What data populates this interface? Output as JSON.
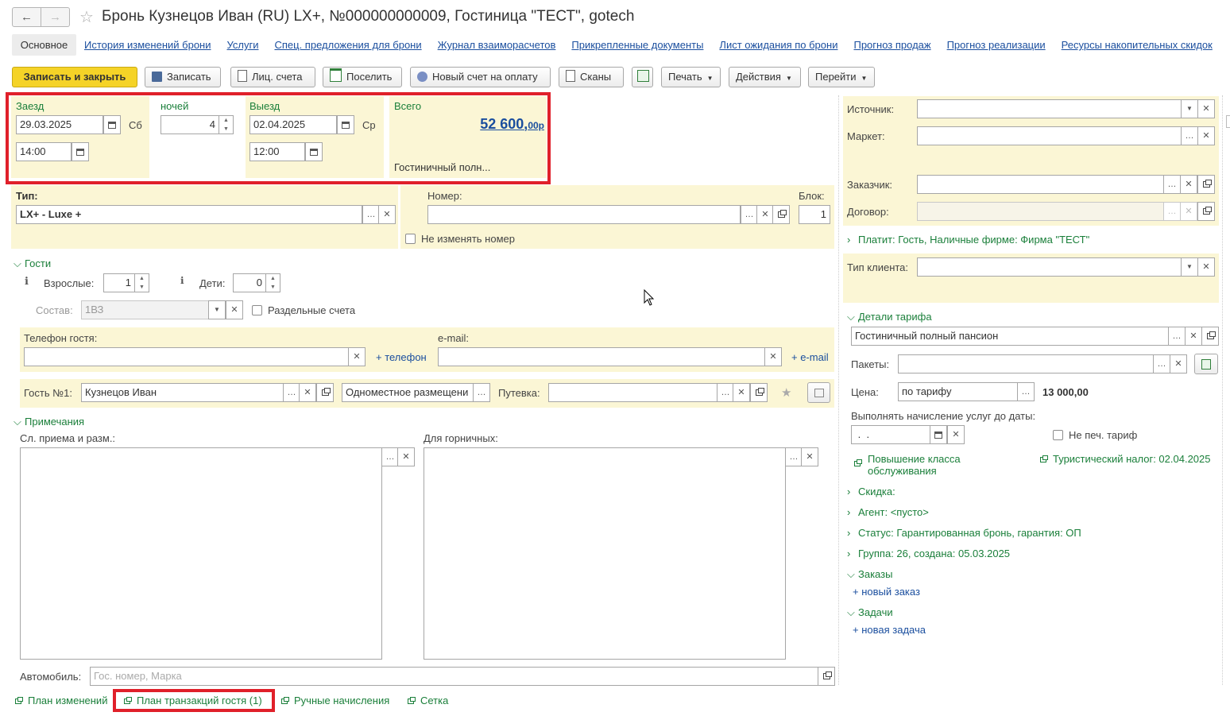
{
  "window": {
    "title": "Бронь Кузнецов Иван (RU) LX+, №000000000009, Гостиница \"ТЕСТ\", gotech",
    "back_icon": "←",
    "forward_icon": "→",
    "star_icon": "☆"
  },
  "nav": {
    "main": "Основное",
    "links": [
      "История изменений брони",
      "Услуги",
      "Спец. предложения для брони",
      "Журнал взаиморасчетов",
      "Прикрепленные документы",
      "Лист ожидания по брони",
      "Прогноз продаж",
      "Прогноз реализации",
      "Ресурсы накопительных скидок"
    ]
  },
  "toolbar": {
    "save_close": "Записать и закрыть",
    "save": "Записать",
    "accounts": "Лиц. счета",
    "settle": "Поселить",
    "new_invoice": "Новый счет на оплату",
    "scans": "Сканы",
    "print": "Печать",
    "actions": "Действия",
    "go": "Перейти"
  },
  "dates": {
    "checkin_label": "Заезд",
    "checkin_date": "29.03.2025",
    "checkin_day": "Сб",
    "checkin_time": "14:00",
    "nights_label": "ночей",
    "nights": "4",
    "checkout_label": "Выезд",
    "checkout_date": "02.04.2025",
    "checkout_day": "Ср",
    "checkout_time": "12:00",
    "total_label": "Всего",
    "total_main": "52 600,",
    "total_cents": "00р",
    "rate_short": "Гостиничный полн..."
  },
  "room": {
    "type_label": "Тип:",
    "type_value": "LX+ - Luxe +",
    "number_label": "Номер:",
    "number_value": "",
    "block_label": "Блок:",
    "block_value": "1",
    "keep_number": "Не изменять номер"
  },
  "guests": {
    "header": "Гости",
    "adults_label": "Взрослые:",
    "adults": "1",
    "children_label": "Дети:",
    "children": "0",
    "composition_label": "Состав:",
    "composition": "1ВЗ",
    "separate_accounts": "Раздельные счета",
    "phone_label": "Телефон гостя:",
    "add_phone": "+ телефон",
    "email_label": "e-mail:",
    "add_email": "+ e-mail",
    "guest1_label": "Гость №1:",
    "guest1_name": "Кузнецов Иван",
    "placement": "Одноместное размещени",
    "voucher_label": "Путевка:"
  },
  "notes": {
    "header": "Примечания",
    "reception_label": "Сл. приема и разм.:",
    "maids_label": "Для горничных:",
    "car_label": "Автомобиль:",
    "car_placeholder": "Гос. номер, Марка"
  },
  "bottom_links": [
    "План изменений",
    "План транзакций гостя (1)",
    "Ручные начисления",
    "Сетка"
  ],
  "right": {
    "source_label": "Источник:",
    "market_label": "Маркет:",
    "customer_label": "Заказчик:",
    "contract_label": "Договор:",
    "payer": "Платит: Гость, Наличные фирме: Фирма \"ТЕСТ\"",
    "client_type_label": "Тип клиента:",
    "tariff_header": "Детали тарифа",
    "tariff_value": "Гостиничный полный пансион",
    "packages_label": "Пакеты:",
    "price_label": "Цена:",
    "price_mode": "по тарифу",
    "price_value": "13 000,00",
    "charge_until_label": "Выполнять начисление услуг до даты:",
    "charge_until_value": " .  .",
    "no_print_tariff": "Не печ. тариф",
    "upgrade": "Повышение класса обслуживания",
    "tourist_tax": "Туристический налог: 02.04.2025",
    "discount": "Скидка:",
    "agent": "Агент: <пусто>",
    "status": "Статус: Гарантированная бронь, гарантия: ОП",
    "group": "Группа: 26, создана: 05.03.2025",
    "orders_header": "Заказы",
    "new_order": "+ новый заказ",
    "tasks_header": "Задачи",
    "new_task": "+ новая задача"
  },
  "colors": {
    "accent_yellow": "#fbf6d5",
    "primary_button": "#f5d327",
    "highlight_red": "#e0202a",
    "section_green": "#1a7f3a",
    "link_blue": "#1a4e9e"
  }
}
